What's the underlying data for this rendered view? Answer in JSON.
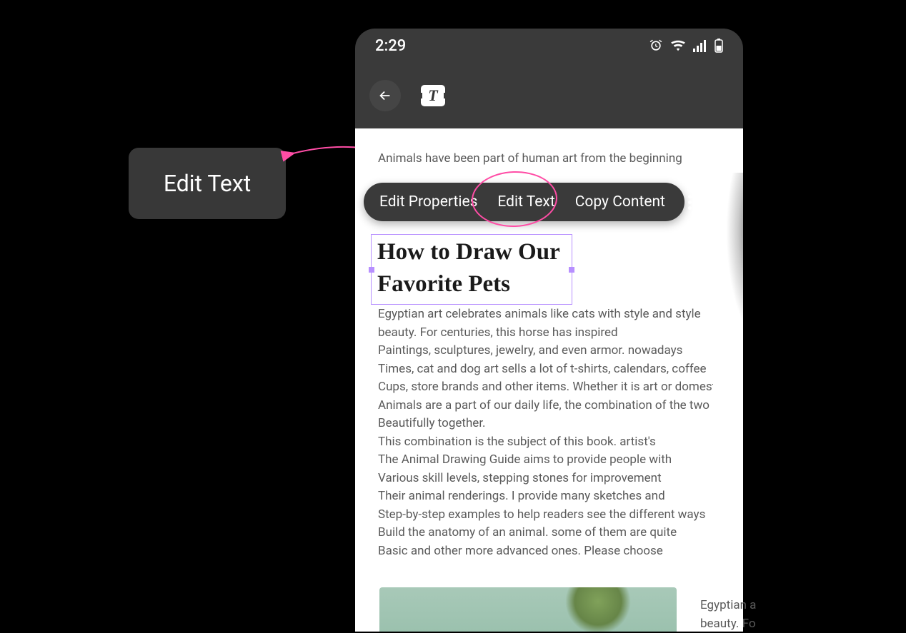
{
  "callout": {
    "label": "Edit Text"
  },
  "status": {
    "time": "2:29"
  },
  "icons": {
    "alarm": "alarm-icon",
    "wifi": "wifi-icon",
    "signal": "signal-icon",
    "battery": "battery-icon",
    "back": "back-arrow-icon",
    "text_tool_glyph": "T",
    "more": "more-vert-icon"
  },
  "context_menu": {
    "items": [
      {
        "label": "Edit Properties"
      },
      {
        "label": "Edit Text"
      },
      {
        "label": "Copy Content"
      }
    ]
  },
  "document": {
    "intro": "Animals have been part of human art from the beginning",
    "title": "How to Draw Our Favorite Pets",
    "body_lines": [
      "Egyptian art celebrates animals like cats with style and style",
      "beauty. For centuries, this horse has inspired",
      "Paintings, sculptures, jewelry, and even armor. nowadays",
      "Times, cat and dog art sells a lot of t-shirts, calendars, coffee",
      "Cups, store brands and other items. Whether it is art or domestic",
      "Animals are a part of our daily life, the combination of the two",
      "Beautifully together.",
      "This combination is the subject of this book. artist's",
      "The Animal Drawing Guide aims to provide people with",
      "Various skill levels, stepping stones for improvement",
      "Their animal renderings. I provide many sketches and",
      "Step-by-step examples to help readers see the different ways",
      "Build the anatomy of an animal. some of them are quite",
      "Basic and other more advanced ones. Please choose"
    ]
  },
  "page2_peek": {
    "line1": "Egyptian a",
    "line2": "beauty. Fo"
  },
  "colors": {
    "highlight": "#ff4da6",
    "selection": "#b78fff",
    "panel": "#3a3a3a"
  }
}
